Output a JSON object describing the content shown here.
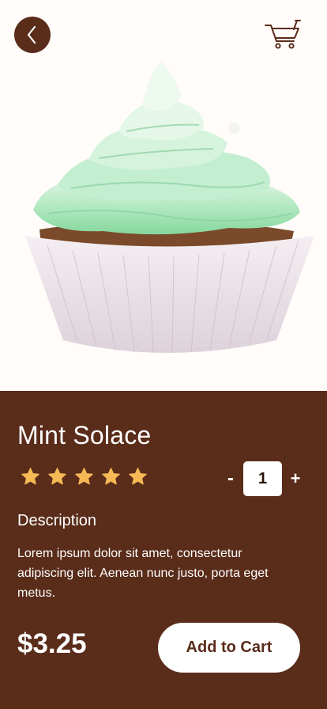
{
  "header": {
    "back_icon": "chevron-left-icon",
    "cart_icon": "shopping-cart-icon"
  },
  "product": {
    "image_subject": "cupcake-with-mint-green-frosting",
    "name": "Mint Solace",
    "rating": 5,
    "rating_max": 5,
    "quantity": "1",
    "quantity_decrement_label": "-",
    "quantity_increment_label": "+",
    "description_heading": "Description",
    "description": "Lorem ipsum dolor sit amet, consectetur adipiscing elit. Aenean nunc justo, porta eget metus.",
    "price": "$3.25",
    "add_to_cart_label": "Add to Cart"
  },
  "colors": {
    "brand_brown": "#5a2c1a",
    "star": "#f7b955",
    "background": "#fffcfa",
    "frosting": "#9fe0b4"
  }
}
